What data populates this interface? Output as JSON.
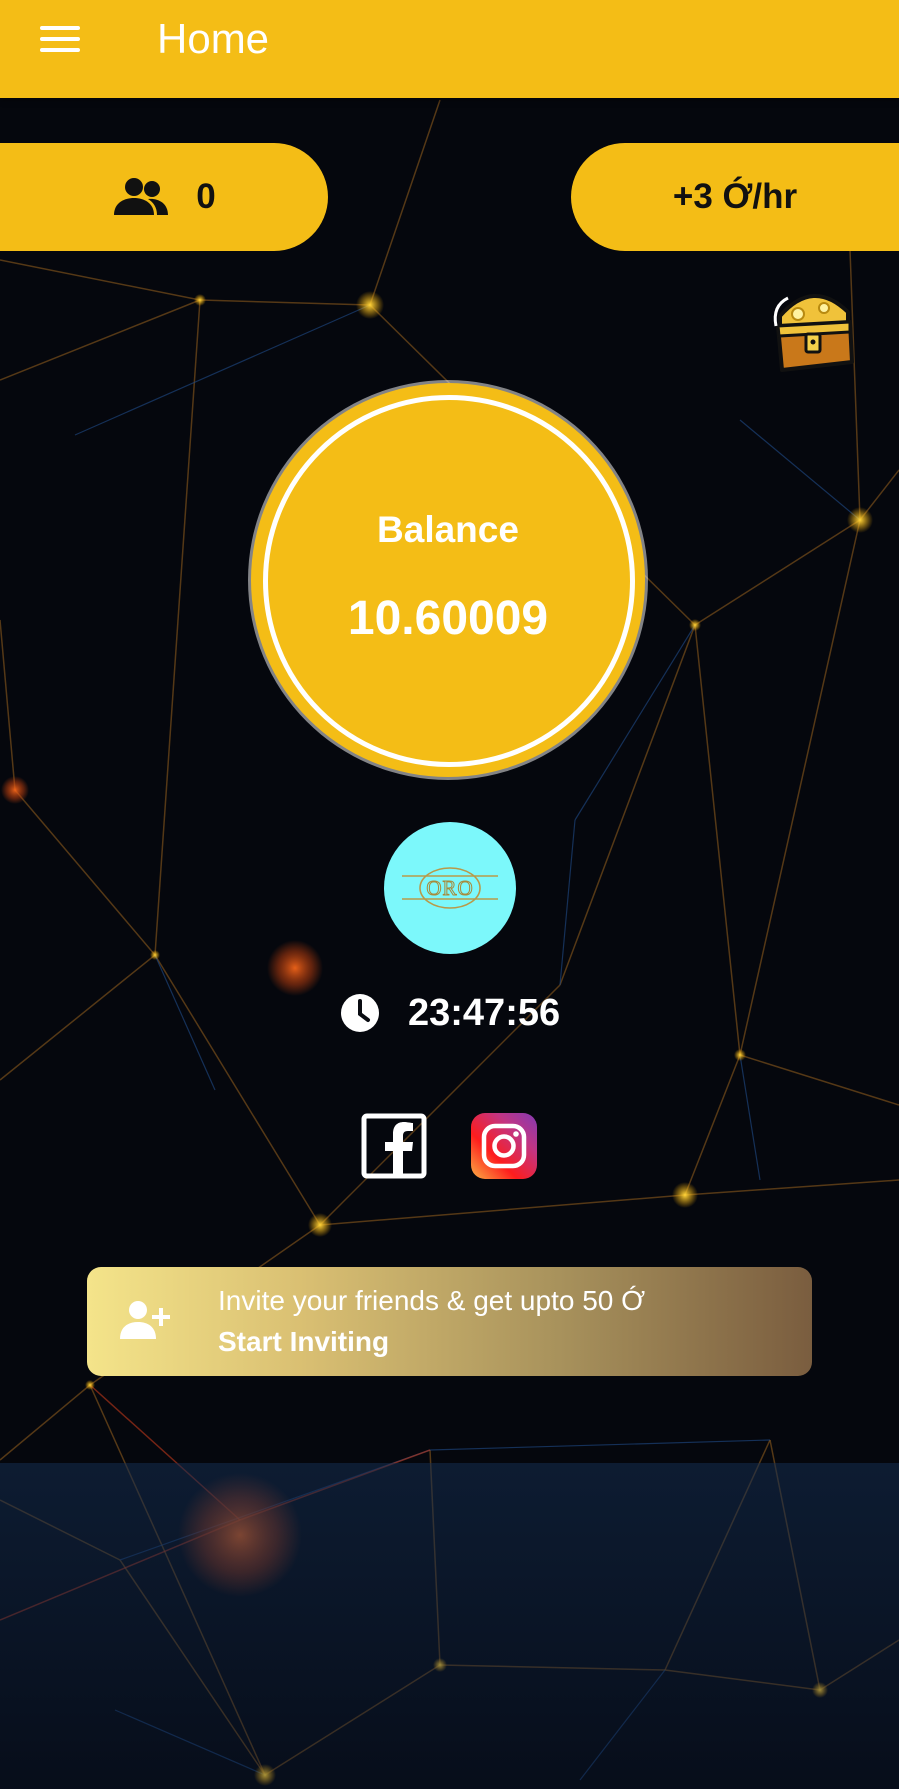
{
  "app": {
    "title": "Home"
  },
  "stats": {
    "referral_count": "0",
    "mining_rate": "+3 Ớ/hr"
  },
  "balance": {
    "label": "Balance",
    "value": "10.60009"
  },
  "logo": {
    "text": "ORO"
  },
  "timer": {
    "value": "23:47:56"
  },
  "invite": {
    "line1": "Invite your friends & get upto 50 Ớ",
    "line2": "Start Inviting"
  },
  "colors": {
    "accent": "#f4bd16",
    "logo_bg": "#7cf8fb",
    "background": "#05070d"
  },
  "icons": [
    "menu-icon",
    "group-icon",
    "treasure-chest-icon",
    "clock-icon",
    "facebook-icon",
    "instagram-icon",
    "add-person-icon"
  ]
}
